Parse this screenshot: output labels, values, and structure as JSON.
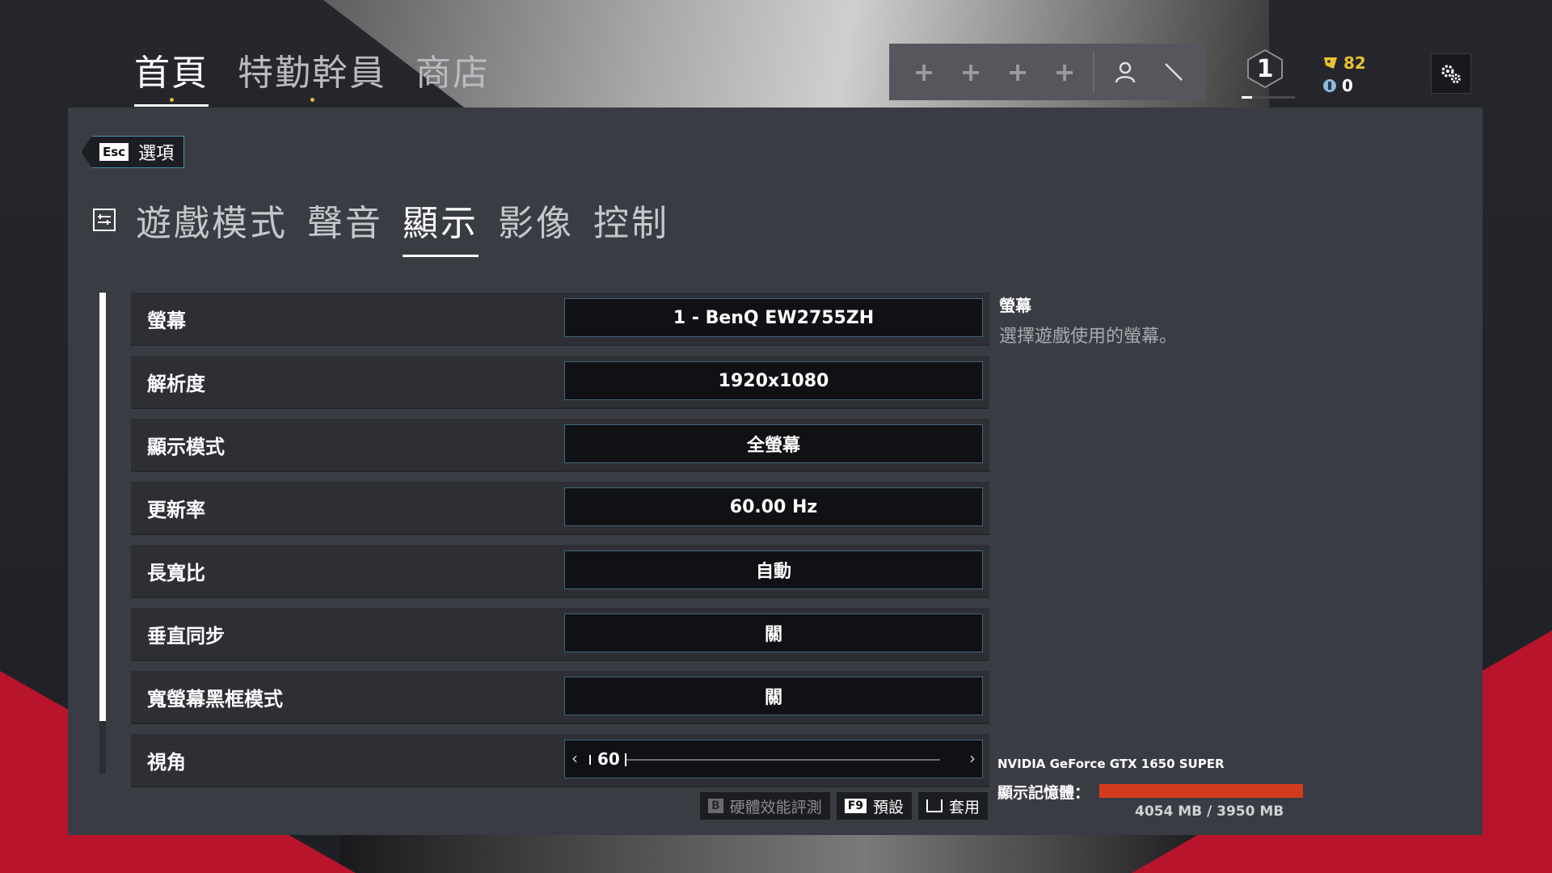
{
  "top_nav": {
    "items": [
      {
        "label": "首頁",
        "active": true
      },
      {
        "label": "特勤幹員",
        "active": false
      },
      {
        "label": "商店",
        "active": false
      }
    ]
  },
  "squad": {
    "slots": [
      "+",
      "+",
      "+",
      "+"
    ]
  },
  "player": {
    "level": "1",
    "level_progress": 0.2,
    "renown": "82",
    "credits": "0"
  },
  "back_button": {
    "key": "Esc",
    "label": "選項"
  },
  "sub_tabs": [
    {
      "label": "遊戲模式",
      "active": false
    },
    {
      "label": "聲音",
      "active": false
    },
    {
      "label": "顯示",
      "active": true
    },
    {
      "label": "影像",
      "active": false
    },
    {
      "label": "控制",
      "active": false
    }
  ],
  "settings": [
    {
      "label": "螢幕",
      "value": "1 - BenQ EW2755ZH"
    },
    {
      "label": "解析度",
      "value": "1920x1080"
    },
    {
      "label": "顯示模式",
      "value": "全螢幕"
    },
    {
      "label": "更新率",
      "value": "60.00 Hz"
    },
    {
      "label": "長寬比",
      "value": "自動"
    },
    {
      "label": "垂直同步",
      "value": "關"
    },
    {
      "label": "寬螢幕黑框模式",
      "value": "關"
    }
  ],
  "fov": {
    "label": "視角",
    "value": "60",
    "min": 60,
    "max": 90
  },
  "scroll_fraction": 0.89,
  "description": {
    "title": "螢幕",
    "text": "選擇遊戲使用的螢幕。"
  },
  "actions": [
    {
      "key": "B",
      "label": "硬體效能評測",
      "disabled": true
    },
    {
      "key": "F9",
      "label": "預設",
      "disabled": false
    },
    {
      "key": "space",
      "label": "套用",
      "disabled": false
    }
  ],
  "gpu": {
    "name": "NVIDIA GeForce GTX 1650 SUPER",
    "vram_label": "顯示記憶體：",
    "vram_text": "4054 MB / 3950 MB",
    "vram_used_fraction": 1.0
  },
  "colors": {
    "accent_red": "#b8142c",
    "renown_gold": "#e8c233",
    "vram_bar": "#d63a1e",
    "field_border": "#3f6978"
  },
  "icons": {
    "settings": "gears-icon",
    "profile": "person-icon",
    "renown": "renown-icon",
    "credits": "r6-credits-icon"
  }
}
